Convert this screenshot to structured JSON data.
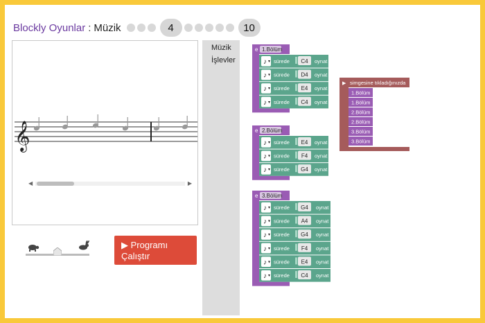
{
  "header": {
    "app_link": "Blockly Oyunlar",
    "separator": ":",
    "page_name": "Müzik",
    "current_level": "4",
    "last_level": "10"
  },
  "run_button": {
    "label": "Programı Çalıştır"
  },
  "toolbox": {
    "categories": [
      "Müzik",
      "İşlevler"
    ]
  },
  "blocks": {
    "sure_label": "sürede",
    "play_label": "oynat",
    "functions": [
      {
        "name": "1.Bölüm",
        "notes": [
          "C4",
          "D4",
          "E4",
          "C4"
        ]
      },
      {
        "name": "2.Bölüm",
        "notes": [
          "E4",
          "F4",
          "G4"
        ]
      },
      {
        "name": "3.Bölüm",
        "notes": [
          "G4",
          "A4",
          "G4",
          "F4",
          "E4",
          "C4"
        ]
      }
    ],
    "event": {
      "label": "simgesine tıkladığınızda",
      "calls": [
        "1.Bölüm",
        "1.Bölüm",
        "2.Bölüm",
        "2.Bölüm",
        "3.Bölüm",
        "3.Bölüm"
      ]
    }
  },
  "colors": {
    "brand": "#6b3aa0",
    "function_block": "#9a5cb4",
    "note_block": "#5ba58c",
    "event_block": "#a55b5b",
    "run_button": "#dd4b39",
    "frame": "#f9c93a"
  }
}
